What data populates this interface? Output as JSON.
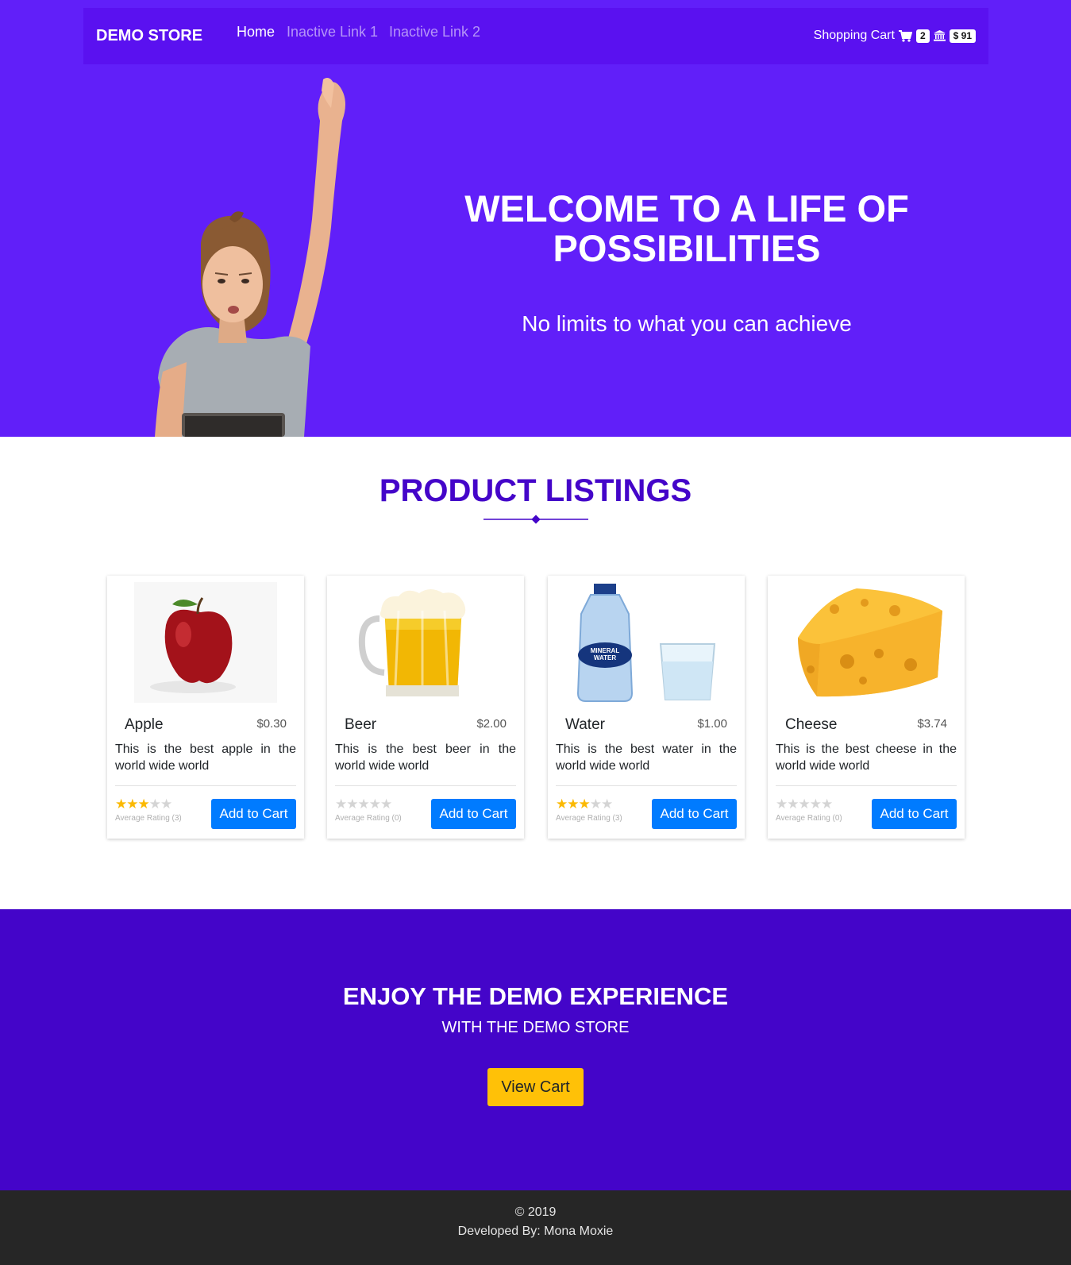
{
  "nav": {
    "brand": "DEMO STORE",
    "links": [
      {
        "label": "Home",
        "active": true
      },
      {
        "label": "Inactive Link 1",
        "active": false
      },
      {
        "label": "Inactive Link 2",
        "active": false
      }
    ],
    "cart_label": "Shopping Cart",
    "cart_count": "2",
    "balance": "$ 91",
    "cart_icon": "shopping-cart-icon",
    "bank_icon": "bank-icon"
  },
  "hero": {
    "title": "WELCOME TO A LIFE OF POSSIBILITIES",
    "subtitle": "No limits to what you can achieve"
  },
  "listings": {
    "title": "PRODUCT LISTINGS",
    "products": [
      {
        "name": "Apple",
        "price": "$0.30",
        "description": "This is the best apple in the world wide world",
        "rating_label": "Average Rating (3)",
        "stars": 3,
        "button": "Add to Cart"
      },
      {
        "name": "Beer",
        "price": "$2.00",
        "description": "This is the best beer in the world wide world",
        "rating_label": "Average Rating (0)",
        "stars": 0,
        "button": "Add to Cart"
      },
      {
        "name": "Water",
        "price": "$1.00",
        "description": "This is the best water in the world wide world",
        "rating_label": "Average Rating (3)",
        "stars": 3,
        "button": "Add to Cart"
      },
      {
        "name": "Cheese",
        "price": "$3.74",
        "description": "This is the best cheese in the world wide world",
        "rating_label": "Average Rating (0)",
        "stars": 0,
        "button": "Add to Cart"
      }
    ],
    "water_bottle_label": [
      "MINERAL",
      "WATER"
    ]
  },
  "cta": {
    "title": "ENJOY THE DEMO EXPERIENCE",
    "subtitle": "WITH THE DEMO STORE",
    "button": "View Cart"
  },
  "footer": {
    "copyright": "© 2019",
    "credit": "Developed By: Mona Moxie"
  },
  "colors": {
    "hero_bg": "#611ff9",
    "nav_bg": "#5a11f0",
    "accent_purple": "#4405c9",
    "button_blue": "#007bff",
    "button_yellow": "#ffc107",
    "star_gold": "#fbb901",
    "footer_bg": "#262626"
  }
}
